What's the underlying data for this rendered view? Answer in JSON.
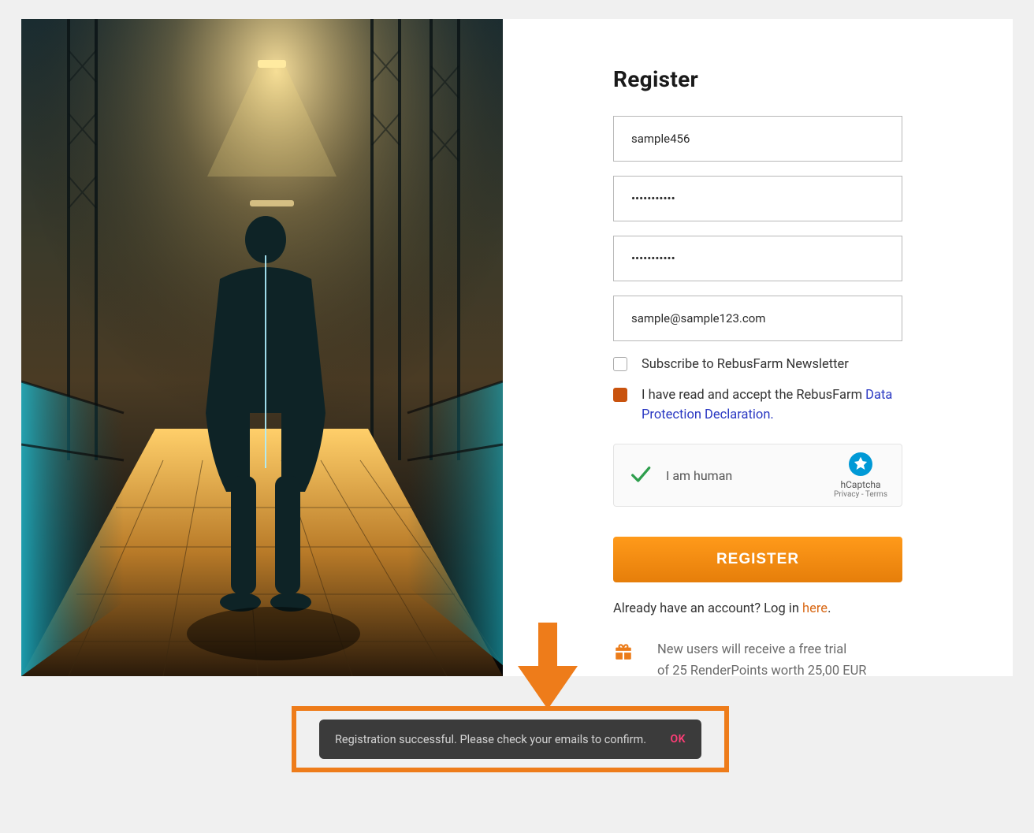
{
  "form": {
    "title": "Register",
    "username": "sample456",
    "password": "•••••••••••",
    "password_confirm": "•••••••••••",
    "email": "sample@sample123.com",
    "newsletter_label": "Subscribe to RebusFarm Newsletter",
    "terms_prefix": "I have read and accept the RebusFarm ",
    "terms_link": "Data Protection Declaration.",
    "captcha_label": "I am human",
    "captcha_brand": "hCaptcha",
    "captcha_links": "Privacy - Terms",
    "submit_label": "REGISTER",
    "login_prefix": "Already have an account? Log in ",
    "login_link": "here",
    "login_suffix": ".",
    "trial_line1": "New users will receive a free trial",
    "trial_line2": "of 25 RenderPoints worth 25,00 EUR"
  },
  "toast": {
    "message": "Registration successful. Please check your emails to confirm.",
    "ok": "OK"
  },
  "colors": {
    "accent": "#eb7c1a",
    "link_blue": "#2a38c2",
    "toast_bg": "#3b3b3b",
    "ok_pink": "#ff3d77"
  }
}
